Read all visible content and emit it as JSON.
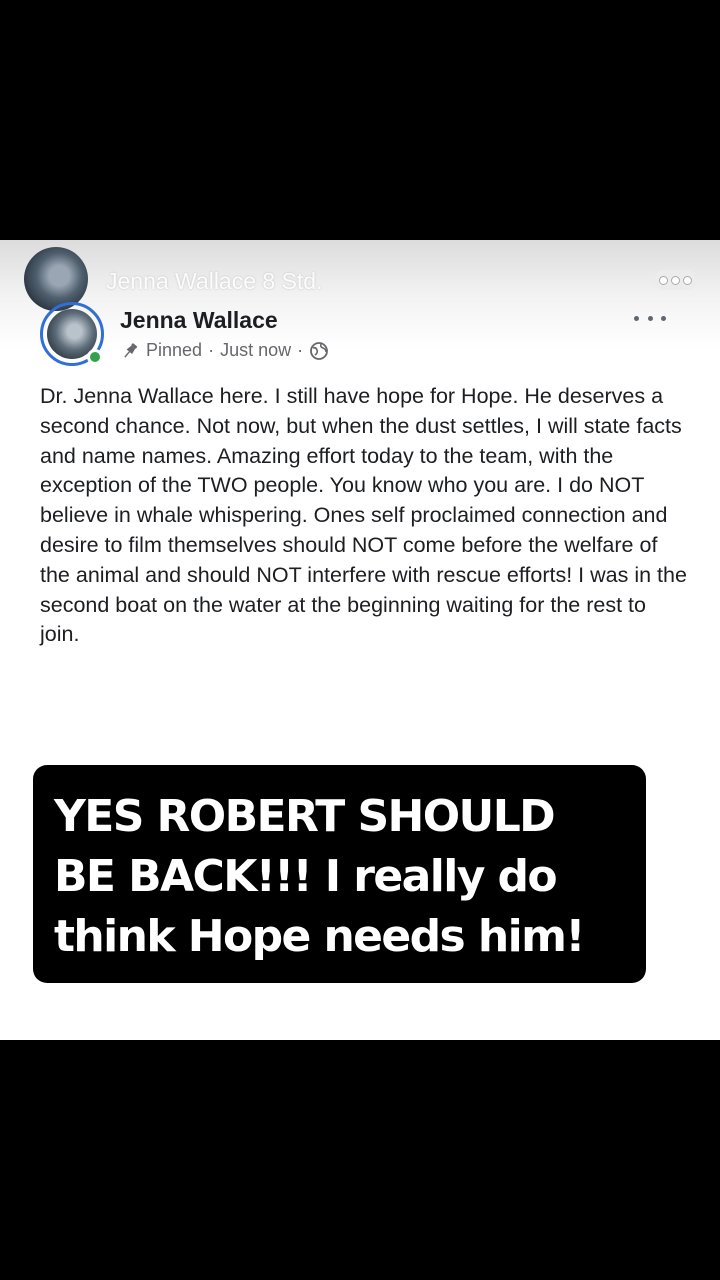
{
  "ghost_header": {
    "name": "Jenna Wallace 8 Std."
  },
  "post": {
    "author": "Jenna Wallace",
    "pinned_label": "Pinned",
    "separator": "·",
    "timestamp": "Just now",
    "body": "Dr. Jenna Wallace here. I still have hope for Hope. He deserves a second chance. Not now, but when the dust settles, I will state facts and name names. Amazing effort today to the team, with the exception of the TWO people. You know who you are. I do NOT believe in whale whispering. Ones self proclaimed connection and desire to film themselves should NOT come before the welfare of the animal and should NOT interfere with rescue efforts! I was in the second boat on the water at the beginning waiting for the rest to join."
  },
  "caption": {
    "text": "YES ROBERT SHOULD BE BACK!!! I really do think Hope needs him!"
  },
  "icons": {
    "pin": "pin-icon",
    "globe": "globe-icon",
    "more": "more-options-icon"
  },
  "colors": {
    "online": "#31a24c",
    "avatar_ring": "#2f6fd6",
    "meta_text": "#65676b"
  }
}
